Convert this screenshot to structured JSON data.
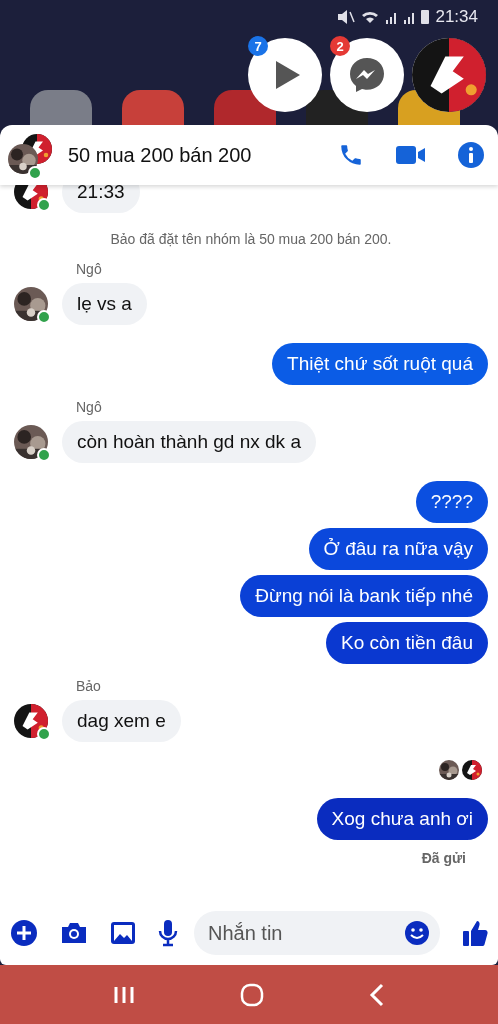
{
  "status_bar": {
    "time": "21:34"
  },
  "chat_heads": [
    {
      "kind": "play",
      "badge": "7",
      "color": "#1a73e8"
    },
    {
      "kind": "messenger",
      "badge": "2",
      "color": "#e53935"
    },
    {
      "kind": "avatar"
    }
  ],
  "conversation": {
    "title": "50 mua 200 bán 200",
    "online": true
  },
  "messages": [
    {
      "kind": "incoming",
      "avatar": {
        "kind": "logo"
      },
      "online": true,
      "bubbles": [
        {
          "text": "21:33"
        }
      ]
    },
    {
      "kind": "system",
      "text": "Bảo đã đặt tên nhóm là 50 mua 200 bán 200."
    },
    {
      "kind": "incoming",
      "sender": "Ngô",
      "avatar": {
        "kind": "photo"
      },
      "online": true,
      "bubbles": [
        {
          "text": "lẹ vs a"
        }
      ]
    },
    {
      "kind": "outgoing",
      "bubbles": [
        {
          "text": "Thiệt chứ sốt ruột quá",
          "color": "#0b5ce6"
        }
      ]
    },
    {
      "kind": "incoming",
      "sender": "Ngô",
      "avatar": {
        "kind": "photo"
      },
      "online": true,
      "bubbles": [
        {
          "text": "còn hoàn thành gd nx dk a"
        }
      ]
    },
    {
      "kind": "outgoing",
      "bubbles": [
        {
          "text": "????",
          "color": "#0b4fe0"
        },
        {
          "text": "Ở đâu ra nữa vậy",
          "color": "#0b48dc"
        },
        {
          "text": "Đừng nói là bank tiếp nhé",
          "color": "#0a40d6"
        },
        {
          "text": "Ko còn tiền đâu",
          "color": "#0a38d0"
        }
      ]
    },
    {
      "kind": "incoming",
      "sender": "Bảo",
      "avatar": {
        "kind": "logo"
      },
      "online": true,
      "bubbles": [
        {
          "text": "dag xem e"
        }
      ]
    },
    {
      "kind": "receipts",
      "avatars": [
        {
          "kind": "photo"
        },
        {
          "kind": "logo"
        }
      ]
    },
    {
      "kind": "outgoing",
      "bubbles": [
        {
          "text": "Xog chưa anh ơi",
          "color": "#0a2cbf"
        }
      ]
    },
    {
      "kind": "status",
      "text": "Đã gửi"
    }
  ],
  "composer": {
    "placeholder": "Nhắn tin"
  }
}
